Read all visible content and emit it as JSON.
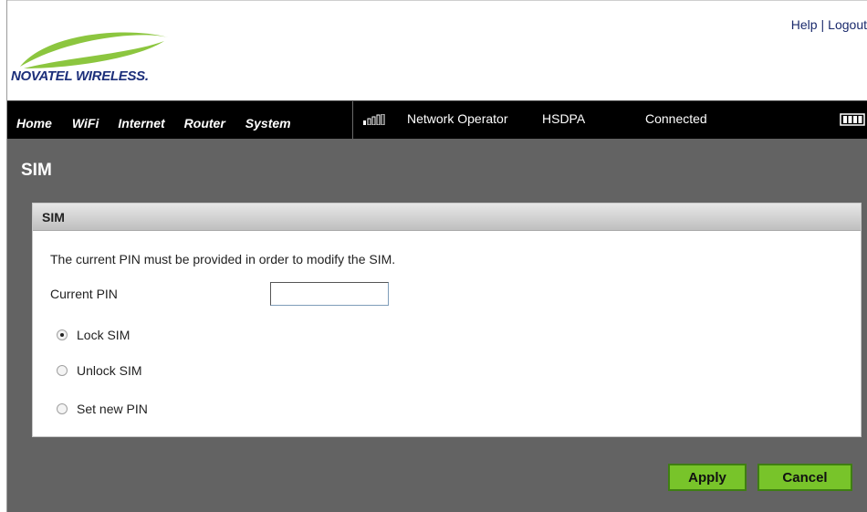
{
  "header": {
    "logo_text": "NOVATEL WIRELESS.",
    "help_label": "Help",
    "link_separator": "|",
    "logout_label": "Logout"
  },
  "nav": {
    "items": [
      "Home",
      "WiFi",
      "Internet",
      "Router",
      "System"
    ]
  },
  "status": {
    "operator": "Network Operator",
    "network_type": "HSDPA",
    "connection": "Connected"
  },
  "page": {
    "title": "SIM"
  },
  "panel": {
    "title": "SIM",
    "info_text": "The current PIN must be provided in order to modify the SIM.",
    "pin_label": "Current PIN",
    "pin_value": "",
    "options": [
      {
        "label": "Lock SIM",
        "checked": true
      },
      {
        "label": "Unlock SIM",
        "checked": false
      },
      {
        "label": "Set new PIN",
        "checked": false
      }
    ]
  },
  "buttons": {
    "apply_label": "Apply",
    "cancel_label": "Cancel"
  },
  "colors": {
    "nav_bg": "#000000",
    "content_bg": "#636363",
    "button_green": "#78c42a",
    "logo_green": "#8cc63f",
    "logo_blue": "#1c2f7a"
  },
  "icons": {
    "signal": "signal-strength-icon",
    "battery": "battery-icon"
  }
}
